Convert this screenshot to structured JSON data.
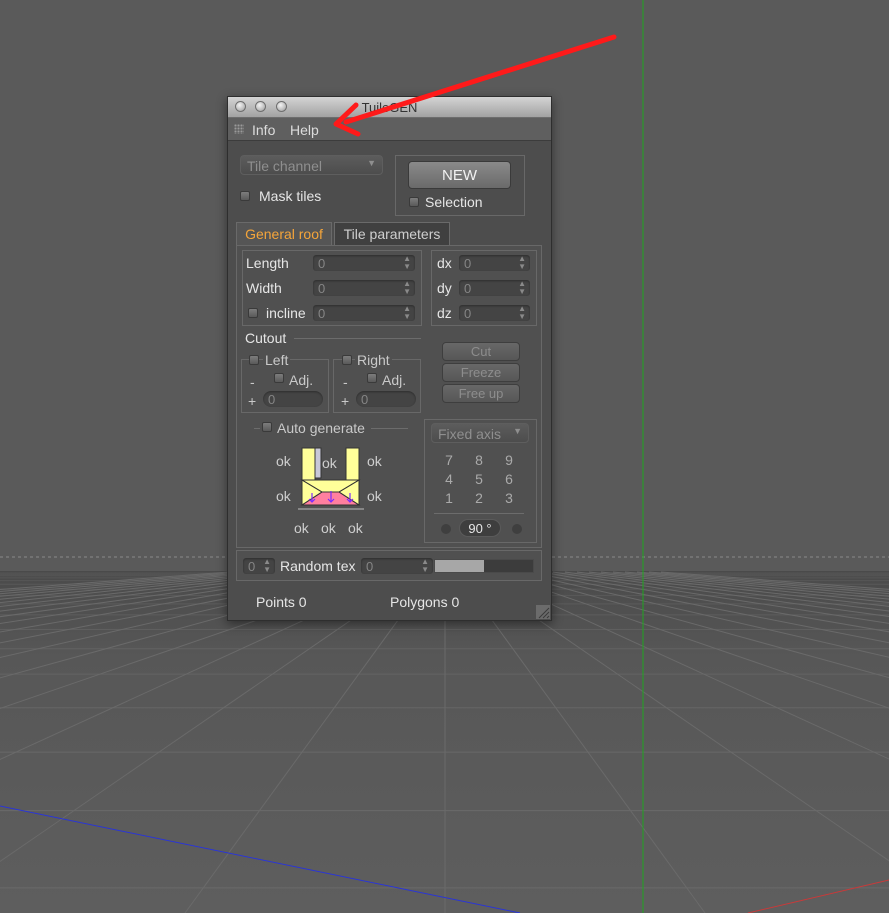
{
  "window": {
    "title": "TuileGEN",
    "menu": {
      "info": "Info",
      "help": "Help"
    }
  },
  "top": {
    "channel_dropdown": "Tile channel",
    "mask_tiles": "Mask tiles",
    "new_button": "NEW",
    "selection": "Selection"
  },
  "tabs": {
    "general_roof": "General roof",
    "tile_parameters": "Tile parameters"
  },
  "dimensions": {
    "length": {
      "label": "Length",
      "value": "0"
    },
    "width": {
      "label": "Width",
      "value": "0"
    },
    "incline": {
      "label": "incline",
      "value": "0"
    }
  },
  "offsets": {
    "dx": {
      "label": "dx",
      "value": "0"
    },
    "dy": {
      "label": "dy",
      "value": "0"
    },
    "dz": {
      "label": "dz",
      "value": "0"
    }
  },
  "cutout": {
    "title": "Cutout",
    "left": {
      "label": "Left",
      "minus": "-",
      "adj": "Adj.",
      "plus": "+",
      "value": "0"
    },
    "right": {
      "label": "Right",
      "minus": "-",
      "adj": "Adj.",
      "plus": "+",
      "value": "0"
    },
    "cut": "Cut",
    "freeze": "Freeze",
    "free_up": "Free up"
  },
  "auto_generate": {
    "label": "Auto generate",
    "ok_top_left": "ok",
    "ok_top_mid": "ok",
    "ok_top_right": "ok",
    "ok_mid_left": "ok",
    "ok_mid_right": "ok",
    "ok_bottom": [
      "ok",
      "ok",
      "ok"
    ]
  },
  "axis": {
    "dropdown": "Fixed axis",
    "numpad": [
      [
        "7",
        "8",
        "9"
      ],
      [
        "4",
        "5",
        "6"
      ],
      [
        "1",
        "2",
        "3"
      ]
    ],
    "angle": "90 °"
  },
  "bottom_bar": {
    "index_value": "0",
    "random_tex_label": "Random tex",
    "random_tex_value": "0",
    "slider_level": 0.5
  },
  "status": {
    "points": "Points 0",
    "polygons": "Polygons 0"
  },
  "colors": {
    "accent_tab": "#f5a53a",
    "arrow": "#ff1a1a",
    "preview_yellow": "#ffff99",
    "preview_pink": "#ff7f9f",
    "preview_arrows": "#7a2aff"
  },
  "icons": {
    "titlebar_buttons": [
      "close-icon",
      "minimize-icon",
      "zoom-icon"
    ],
    "menu_grip": "grip-icon",
    "resize": "resize-grip-icon",
    "annotation": "red-arrow-icon"
  }
}
